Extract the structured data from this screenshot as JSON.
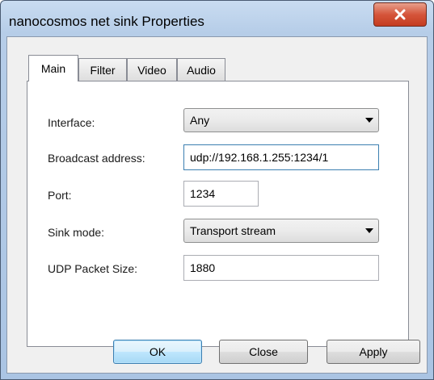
{
  "window": {
    "title": "nanocosmos net sink Properties",
    "close_glyph": "✕"
  },
  "tabs": [
    {
      "label": "Main",
      "active": true
    },
    {
      "label": "Filter",
      "active": false
    },
    {
      "label": "Video",
      "active": false
    },
    {
      "label": "Audio",
      "active": false
    }
  ],
  "form": {
    "interface_label": "Interface:",
    "interface_value": "Any",
    "broadcast_label": "Broadcast address:",
    "broadcast_value": "udp://192.168.1.255:1234/1",
    "port_label": "Port:",
    "port_value": "1234",
    "sink_mode_label": "Sink mode:",
    "sink_mode_value": "Transport stream",
    "udp_packet_label": "UDP Packet Size:",
    "udp_packet_value": "1880"
  },
  "buttons": {
    "ok": "OK",
    "close": "Close",
    "apply": "Apply"
  },
  "colors": {
    "title_close_red": "#c43c20",
    "default_button_blue": "#a7d9f5"
  }
}
